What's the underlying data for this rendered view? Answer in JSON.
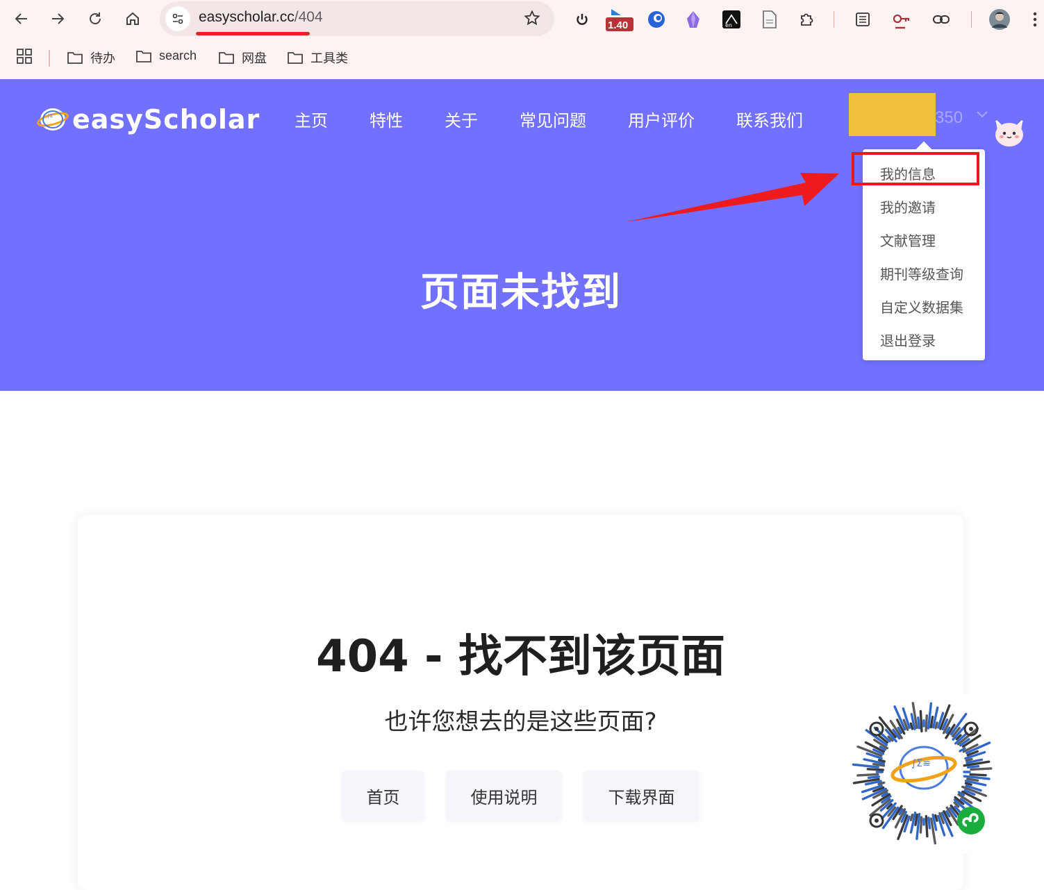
{
  "browser": {
    "url_host": "easyscholar.cc",
    "url_path": "/404",
    "ext_badge": "1.40",
    "bookmarks": [
      "待办",
      "search",
      "网盘",
      "工具类"
    ]
  },
  "site": {
    "logo_text": "easyScholar",
    "nav": [
      "主页",
      "特性",
      "关于",
      "常见问题",
      "用户评价",
      "联系我们"
    ],
    "user_suffix": "350",
    "hero_title": "页面未找到",
    "dropdown": [
      "我的信息",
      "我的邀请",
      "文献管理",
      "期刊等级查询",
      "自定义数据集",
      "退出登录"
    ],
    "error_title": "404 - 找不到该页面",
    "error_subtitle": "也许您想去的是这些页面?",
    "links": [
      "首页",
      "使用说明",
      "下载界面"
    ]
  },
  "colors": {
    "hero_bg": "#7270ff",
    "highlight": "#e8191c",
    "user_block": "#f2be3d"
  }
}
